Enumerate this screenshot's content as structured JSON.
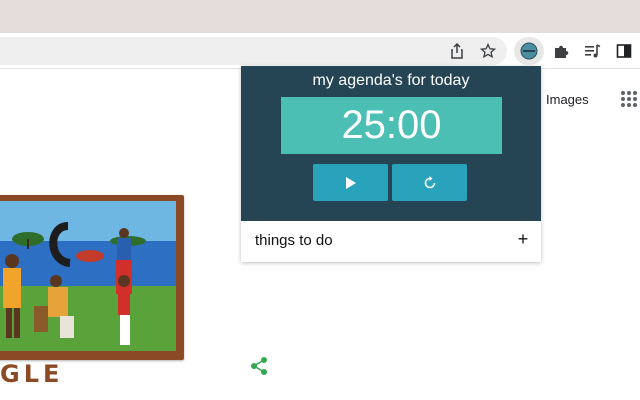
{
  "browser": {
    "toolbar_icons": [
      "share-icon",
      "star-icon",
      "agenda-extension-icon",
      "puzzle-icon",
      "media-control-icon",
      "side-panel-icon"
    ]
  },
  "page": {
    "images_link": "Images",
    "apps_icon": "apps-grid-icon",
    "doodle_word": "GLE",
    "share_icon": "share-icon"
  },
  "popup": {
    "title": "my agenda's for today",
    "timer": "25:00",
    "play_icon": "play-icon",
    "reset_icon": "reset-icon",
    "todo_label": "things to do",
    "add_label": "+"
  },
  "colors": {
    "popup_header": "#254554",
    "timer_bg": "#4bbfb3",
    "button_bg": "#28a3bb",
    "tabstrip": "#e4dcdb"
  }
}
